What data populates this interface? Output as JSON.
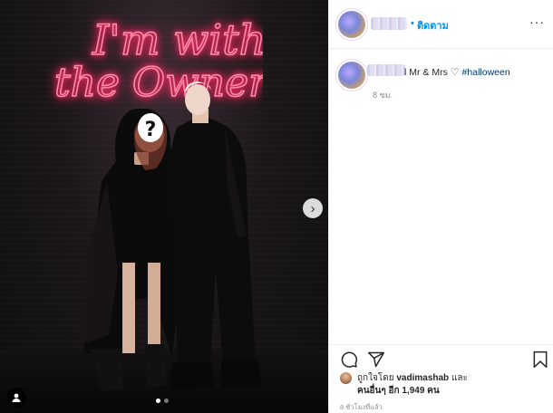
{
  "post": {
    "follow_dot": "•",
    "follow_label": "ติดตาม",
    "more_label": "···",
    "caption_text": "l Mr & Mrs",
    "caption_heart": "♡",
    "caption_hashtag": "#halloween",
    "caption_time": "8 ชม."
  },
  "media": {
    "neon_line1": "I'm with",
    "neon_line2": "the Owner",
    "face_mark": "?",
    "next_arrow": "›",
    "carousel_pages": 2,
    "carousel_active": 1
  },
  "engagement": {
    "liked_by_prefix": "ถูกใจโดย",
    "liked_by_user": "vadimashab",
    "liked_by_and": "และ",
    "others_label": "คนอื่นๆ อีก 1,949 คน",
    "post_time": "8 ชั่วโมงที่แล้ว"
  },
  "icons": {
    "comment": "comment-icon",
    "share": "share-icon",
    "save": "bookmark-icon",
    "tag": "user-tag-icon",
    "next": "chevron-right-icon"
  },
  "colors": {
    "accent": "#0095f6",
    "hashtag": "#00376b",
    "neon": "#ff2f6d",
    "muted": "#8e8e8e"
  }
}
